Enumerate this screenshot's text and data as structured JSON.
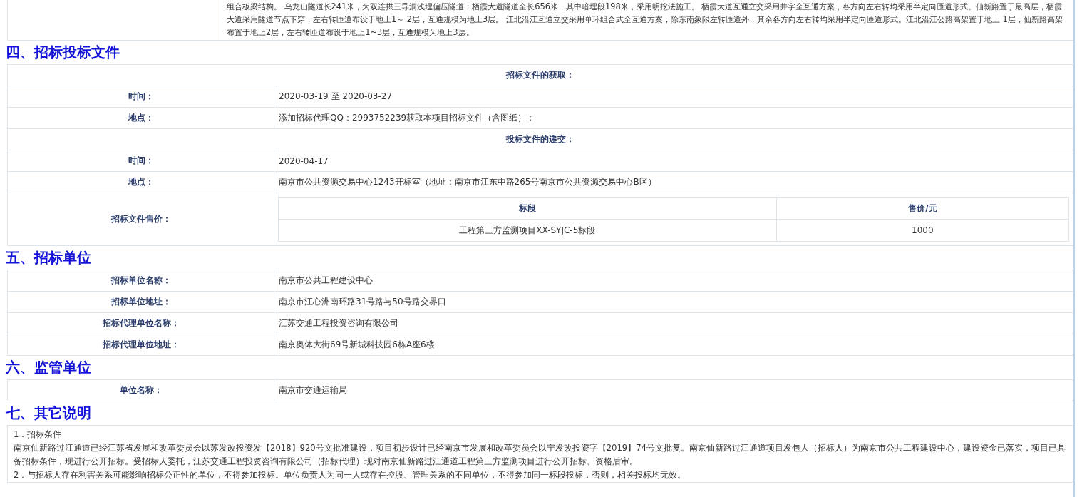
{
  "intro_text": "组合板梁结构。 乌龙山隧道长241米，为双连拱三导洞浅埋偏压隧道；栖霞大道隧道全长656米，其中暗埋段198米，采用明挖法施工。 栖霞大道互通立交采用井字全互通方案，各方向左右转均采用半定向匝道形式。仙新路置于最高层，栖霞大道采用隧道节点下穿，左右转匝道布设于地上1～ 2层，互通规模为地上3层。 江北沿江互通立交采用单环组合式全互通方案，除东南象限左转匝道外，其余各方向左右转均采用半定向匝道形式。江北沿江公路高架置于地上 1层，仙新路高架布置于地上2层，左右转匝道布设于地上1~3层，互通规模为地上3层。",
  "sections": [
    {
      "title": "四、招标投标文件",
      "rows": [
        {
          "kind": "header",
          "text": "招标文件的获取："
        },
        {
          "kind": "field",
          "label": "时间：",
          "value": "2020-03-19 至 2020-03-27"
        },
        {
          "kind": "field",
          "label": "地点：",
          "value": "添加招标代理QQ：2993752239获取本项目招标文件（含图纸）；"
        },
        {
          "kind": "header",
          "text": "投标文件的递交："
        },
        {
          "kind": "field",
          "label": "时间：",
          "value": "2020-04-17"
        },
        {
          "kind": "field",
          "label": "地点：",
          "value": "南京市公共资源交易中心1243开标室（地址：南京市江东中路265号南京市公共资源交易中心B区）"
        },
        {
          "kind": "price",
          "label": "招标文件售价：",
          "columns": [
            "标段",
            "售价/元"
          ],
          "rows": [
            [
              "工程第三方监测项目XX-SYJC-5标段",
              "1000"
            ]
          ]
        }
      ]
    },
    {
      "title": "五、招标单位",
      "rows": [
        {
          "kind": "field",
          "label": "招标单位名称：",
          "value": "南京市公共工程建设中心"
        },
        {
          "kind": "field",
          "label": "招标单位地址：",
          "value": "南京市江心洲南环路31号路与50号路交界口"
        },
        {
          "kind": "field",
          "label": "招标代理单位名称：",
          "value": "江苏交通工程投资咨询有限公司"
        },
        {
          "kind": "field",
          "label": "招标代理单位地址：",
          "value": "南京奥体大街69号新城科技园6栋A座6楼"
        }
      ]
    },
    {
      "title": "六、监管单位",
      "rows": [
        {
          "kind": "field",
          "label": "单位名称：",
          "value": "南京市交通运输局"
        }
      ]
    },
    {
      "title": "七、其它说明",
      "paragraphs": [
        "1．招标条件",
        "南京仙新路过江通道已经江苏省发展和改革委员会以苏发改投资发【2018】920号文批准建设，项目初步设计已经南京市发展和改革委员会以宁发改投资字【2019】74号文批复。南京仙新路过江通道项目发包人（招标人）为南京市公共工程建设中心，建设资金已落实，项目已具备招标条件，现进行公开招标。受招标人委托，江苏交通工程投资咨询有限公司（招标代理）现对南京仙新路过江通道工程第三方监测项目进行公开招标、资格后审。",
        "2．与招标人存在利害关系可能影响招标公正性的单位，不得参加投标。单位负责人为同一人或存在控股、管理关系的不同单位，不得参加同一标段投标，否则，相关投标均无效。"
      ]
    }
  ]
}
